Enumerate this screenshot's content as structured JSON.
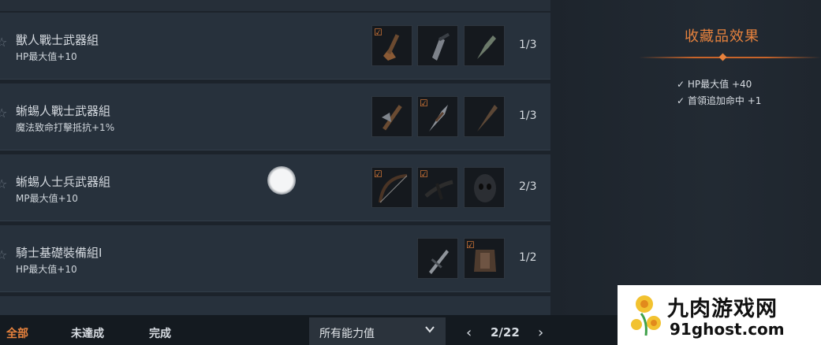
{
  "sets": [
    {
      "name": "獸人戰士武器組",
      "bonus": "HP最大值+10",
      "progress": "1/3",
      "items": [
        {
          "icon": "orc-axe-icon",
          "owned": true
        },
        {
          "icon": "orc-dagger-icon",
          "owned": false
        },
        {
          "icon": "orc-club-icon",
          "owned": false
        }
      ]
    },
    {
      "name": "蜥蜴人戰士武器組",
      "bonus": "魔法致命打擊抵抗+1%",
      "progress": "1/3",
      "items": [
        {
          "icon": "lizard-axe-icon",
          "owned": false
        },
        {
          "icon": "lizard-spear-icon",
          "owned": true
        },
        {
          "icon": "lizard-club-icon",
          "owned": false
        }
      ]
    },
    {
      "name": "蜥蜴人士兵武器組",
      "bonus": "MP最大值+10",
      "progress": "2/3",
      "items": [
        {
          "icon": "lizard-bow-icon",
          "owned": true
        },
        {
          "icon": "lizard-crossbow-icon",
          "owned": true
        },
        {
          "icon": "lizard-helmet-icon",
          "owned": false
        }
      ]
    },
    {
      "name": "騎士基礎裝備組Ⅰ",
      "bonus": "HP最大值+10",
      "progress": "1/2",
      "items": [
        {
          "icon": "knight-sword-icon",
          "owned": false
        },
        {
          "icon": "knight-armor-icon",
          "owned": true
        }
      ]
    }
  ],
  "effects": {
    "title": "收藏品效果",
    "items": [
      "HP最大值 +40",
      "首領追加命中 +1"
    ],
    "check_glyph": "✓"
  },
  "filters": {
    "all": "全部",
    "incomplete": "未達成",
    "complete": "完成",
    "active_color": "#e7823d"
  },
  "dropdown": {
    "selected": "所有能力值"
  },
  "pager": {
    "prev": "‹",
    "label": "2/22",
    "next": "›"
  },
  "watermark": {
    "line1": "九肉游戏网",
    "line2": "91ghost.com"
  }
}
